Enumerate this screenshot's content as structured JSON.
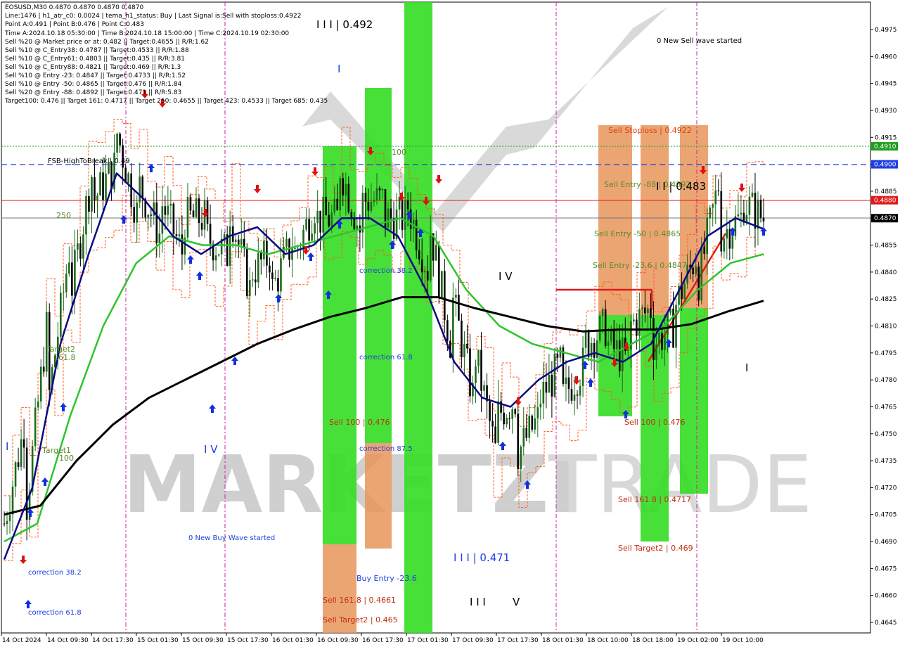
{
  "header": {
    "lines": [
      "EOSUSD,M30  0.4870 0.4870 0.4870 0.4870",
      "Line:1476 | h1_atr_c0: 0.0024 | tema_h1_status: Buy | Last Signal is:Sell with stoploss:0.4922",
      "Point A:0.491 | Point B:0.476 | Point C:0.483",
      "Time A:2024.10.18 05:30:00 | Time B:2024.10.18 15:00:00 | Time C:2024.10.19 02:30:00",
      "Sell %20 @ Market price or at: 0.482 || Target:0.4655 || R/R:1.62",
      "Sell %10 @ C_Entry38: 0.4787 || Target:0.4533 || R/R:1.88",
      "Sell %10 @ C_Entry61: 0.4803 || Target:0.435 || R/R:3.81",
      "Sell %10 @ C_Entry88: 0.4821 || Target:0.469 || R/R:1.3",
      "Sell %10 @ Entry -23: 0.4847 || Target:0.4733 || R/R:1.52",
      "Sell %10 @ Entry -50: 0.4865 || Target:0.476 || R/R:1.84",
      "Sell %20 @ Entry -88: 0.4892 || Target:0.471 || R/R:5.83",
      "Target100: 0.476 || Target 161: 0.4717 || Target 250: 0.4655 || Target 423: 0.4533 || Target 685: 0.435"
    ]
  },
  "watermark": {
    "text_left": "MARKETZI",
    "text_right": "TRADE"
  },
  "price_axis": {
    "ticks": [
      "0.4975",
      "0.4960",
      "0.4945",
      "0.4930",
      "0.4915",
      "0.4900",
      "0.4885",
      "0.4870",
      "0.4855",
      "0.4840",
      "0.4825",
      "0.4810",
      "0.4795",
      "0.4780",
      "0.4765",
      "0.4750",
      "0.4735",
      "0.4720",
      "0.4705",
      "0.4690",
      "0.4675",
      "0.4660",
      "0.4645"
    ],
    "badges": [
      {
        "value": "0.4910",
        "color": "#1e9e1e"
      },
      {
        "value": "0.4900",
        "color": "#1f3fe0"
      },
      {
        "value": "0.4880",
        "color": "#e01a1a"
      },
      {
        "value": "0.4870",
        "color": "#000000"
      }
    ]
  },
  "time_axis": {
    "ticks": [
      "14 Oct 2024",
      "14 Oct 09:30",
      "14 Oct 17:30",
      "15 Oct 01:30",
      "15 Oct 09:30",
      "15 Oct 17:30",
      "16 Oct 01:30",
      "16 Oct 09:30",
      "16 Oct 17:30",
      "17 Oct 01:30",
      "17 Oct 09:30",
      "17 Oct 17:30",
      "18 Oct 01:30",
      "18 Oct 10:00",
      "18 Oct 18:00",
      "19 Oct 02:00",
      "19 Oct 10:00"
    ]
  },
  "annotations": {
    "fsb": "FSB-HighToBreak | 0.49",
    "n250": "250",
    "n100a": "100",
    "target2": "Target2",
    "t1618": "161.8",
    "target1": "Target1",
    "n100b": "100",
    "wave_iii_top": "I I I | 0.492",
    "wave_i_top": "I",
    "wave_iv": "I V",
    "wave_iv_left": "I V",
    "wave_i_left": "I",
    "corr382_mid": "correction 38.2",
    "corr618_mid": "correction 61.8",
    "corr875": "correction 87.5",
    "sell100_left": "Sell 100 | 0.476",
    "sell1618_left": "Sell 161.8 | 0.4661",
    "sell_target2_left": "Sell Target2 | 0.465",
    "buy_entry": "Buy Entry -23.6",
    "wave_iii_bottom": "I I I | 0.471",
    "wave_iii_small": "I I I",
    "wave_v": "V",
    "new_buy": "0 New Buy Wave started",
    "corr382_left": "correction 38.2",
    "corr618_left": "correction 61.8",
    "new_sell": "0 New Sell wave started",
    "sell_stoploss": "Sell Stoploss | 0.4922",
    "sell_entry_88": "Sell Entry -88 | 0.4892",
    "wave_ii": "I I | 0.483",
    "sell_entry_50": "Sell Entry -50 | 0.4865",
    "sell_entry_236": "Sell Entry -23.6 | 0.4847",
    "sell100_right": "Sell 100 | 0.476",
    "sell1618_right": "Sell 161.8 | 0.4717",
    "sell_target2_right": "Sell Target2 | 0.469",
    "wave_i_right": "I"
  },
  "colors": {
    "green_zone": "#33dd22",
    "orange_zone": "#e8955a",
    "ma_black": "#000000",
    "ma_navy": "#0a0a80",
    "ma_green": "#2ec42e",
    "fsb_line": "#1f3fe0",
    "red_line": "#e01a1a",
    "grey_line": "#777777",
    "green_dotted": "#1e9e1e",
    "vline": "#cc2299",
    "up_arrow": "#1030e0",
    "down_arrow": "#e01010"
  },
  "chart_data": {
    "type": "candlestick",
    "symbol": "EOSUSD",
    "timeframe": "M30",
    "ylim": [
      0.464,
      0.499
    ],
    "levels": {
      "fsb_high_to_break": 0.49,
      "green_dotted": 0.491,
      "red_solid": 0.488,
      "current_price": 0.487,
      "sell_stoploss": 0.4922,
      "sell_entry_88": 0.4892,
      "sell_entry_50": 0.4865,
      "sell_entry_23_6": 0.4847,
      "sell_100": 0.476,
      "sell_161_8": 0.4717,
      "sell_target2": 0.469,
      "left_sell_161_8": 0.4661,
      "left_sell_target2": 0.465
    },
    "price_path": [
      [
        0.47,
        0.468
      ],
      [
        0.471,
        0.476
      ],
      [
        0.477,
        0.482
      ],
      [
        0.483,
        0.486
      ],
      [
        0.488,
        0.49
      ],
      [
        0.492,
        0.49
      ],
      [
        0.489,
        0.487
      ],
      [
        0.488,
        0.486
      ],
      [
        0.487,
        0.485
      ],
      [
        0.486,
        0.487
      ],
      [
        0.488,
        0.485
      ],
      [
        0.484,
        0.483
      ],
      [
        0.483,
        0.485
      ],
      [
        0.485,
        0.486
      ],
      [
        0.487,
        0.488
      ],
      [
        0.49,
        0.487
      ],
      [
        0.488,
        0.486
      ],
      [
        0.487,
        0.488
      ],
      [
        0.488,
        0.487
      ],
      [
        0.487,
        0.484
      ],
      [
        0.483,
        0.48
      ],
      [
        0.48,
        0.477
      ],
      [
        0.476,
        0.474
      ],
      [
        0.474,
        0.477
      ],
      [
        0.477,
        0.476
      ],
      [
        0.477,
        0.479
      ],
      [
        0.48,
        0.479
      ],
      [
        0.48,
        0.481
      ],
      [
        0.481,
        0.479
      ],
      [
        0.48,
        0.482
      ],
      [
        0.482,
        0.481
      ],
      [
        0.483,
        0.485
      ],
      [
        0.486,
        0.489
      ],
      [
        0.488,
        0.487
      ],
      [
        0.486,
        0.487
      ]
    ],
    "ma_black": [
      0.4705,
      0.471,
      0.4735,
      0.4755,
      0.477,
      0.478,
      0.479,
      0.48,
      0.4808,
      0.4815,
      0.482,
      0.4826,
      0.4826,
      0.482,
      0.4815,
      0.481,
      0.4807,
      0.4808,
      0.4808,
      0.4811,
      0.4818,
      0.4824
    ],
    "ma_navy": [
      0.468,
      0.472,
      0.48,
      0.485,
      0.4895,
      0.488,
      0.486,
      0.485,
      0.486,
      0.4865,
      0.485,
      0.4855,
      0.487,
      0.487,
      0.486,
      0.483,
      0.479,
      0.477,
      0.4765,
      0.478,
      0.479,
      0.4795,
      0.479,
      0.48,
      0.483,
      0.486,
      0.487,
      0.4864
    ],
    "ma_green": [
      0.469,
      0.47,
      0.476,
      0.481,
      0.4845,
      0.486,
      0.4855,
      0.4855,
      0.485,
      0.4855,
      0.486,
      0.4865,
      0.487,
      0.486,
      0.483,
      0.481,
      0.48,
      0.4795,
      0.479,
      0.48,
      0.481,
      0.483,
      0.4845,
      0.485
    ]
  }
}
